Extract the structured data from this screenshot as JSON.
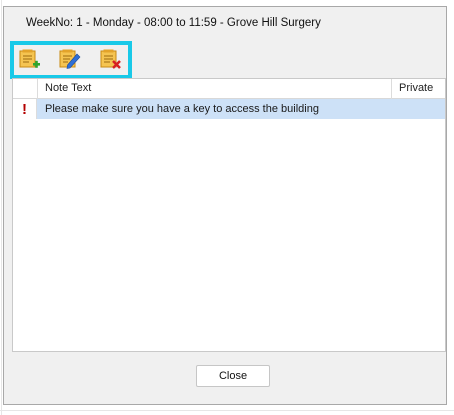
{
  "dialog": {
    "title": "WeekNo: 1 - Monday - 08:00 to 11:59 - Grove Hill Surgery"
  },
  "toolbar": {
    "highlight_color": "#19c9e8",
    "buttons": [
      {
        "icon": "add-note-icon"
      },
      {
        "icon": "edit-note-icon"
      },
      {
        "icon": "delete-note-icon"
      }
    ]
  },
  "notes_table": {
    "columns": [
      "Note Text",
      "Private"
    ],
    "rows": [
      {
        "indicator": "!",
        "note_text": "Please make sure you have a key to access the building",
        "private": "",
        "selected": true
      }
    ],
    "selected_row_color": "#cde1f7"
  },
  "footer": {
    "close_label": "Close"
  }
}
